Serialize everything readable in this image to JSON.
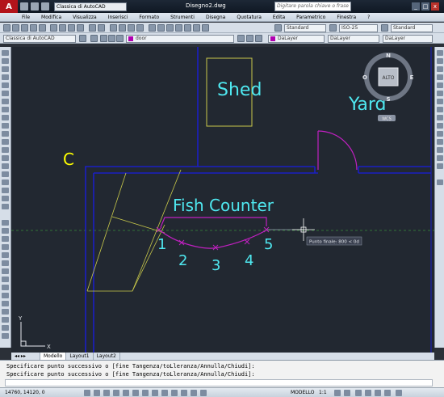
{
  "window": {
    "app_logo": "A",
    "workspace": "Classica di AutoCAD",
    "title": "Disegno2.dwg",
    "search_placeholder": "Digitare parola chiave o frase",
    "minimize": "_",
    "restore": "□",
    "close": "x"
  },
  "menu": [
    "File",
    "Modifica",
    "Visualizza",
    "Inserisci",
    "Formato",
    "Strumenti",
    "Disegna",
    "Quotatura",
    "Edita",
    "Parametrico",
    "Finestra",
    "?"
  ],
  "toolbar2": {
    "workspace_combo": "Classica di AutoCAD",
    "text_style": "Standard",
    "dim_style": "ISO-25",
    "table_style": "Standard",
    "ml_style": "Standard"
  },
  "toolbar3": {
    "layer": "door",
    "color": "DaLayer",
    "linetype": "DaLayer",
    "lineweight": "DaLayer",
    "layer_color": "#b000b0"
  },
  "drawing": {
    "labels": {
      "shed": "Shed",
      "yard": "Yard",
      "c": "C",
      "fish_counter": "Fish Counter",
      "p1": "1",
      "p2": "2",
      "p3": "3",
      "p4": "4",
      "p5": "5"
    },
    "tooltip": "Punto finale: 800 < 0d",
    "colors": {
      "walls": "#1b1fc4",
      "shed": "#c9c94a",
      "text": "#4fe8f0",
      "c_label": "#ffff00",
      "counter": "#c020c0",
      "construction": "#c9c94a",
      "curve": "#c020c0"
    }
  },
  "viewcube": {
    "north": "N",
    "south": "S",
    "east": "E",
    "west": "O",
    "face": "ALTO",
    "wcs": "WCS"
  },
  "ucs": {
    "x": "X",
    "y": "Y"
  },
  "tabs": [
    "Modello",
    "Layout1",
    "Layout2"
  ],
  "command": {
    "history": [
      "Specificare punto successivo o [fine Tangenza/toLleranza/Annulla/Chiudi]:",
      "Specificare punto successivo o [fine Tangenza/toLleranza/Annulla/Chiudi]:"
    ]
  },
  "status": {
    "coords": "14760, 14120, 0",
    "model": "MODELLO",
    "scale": "1:1"
  }
}
